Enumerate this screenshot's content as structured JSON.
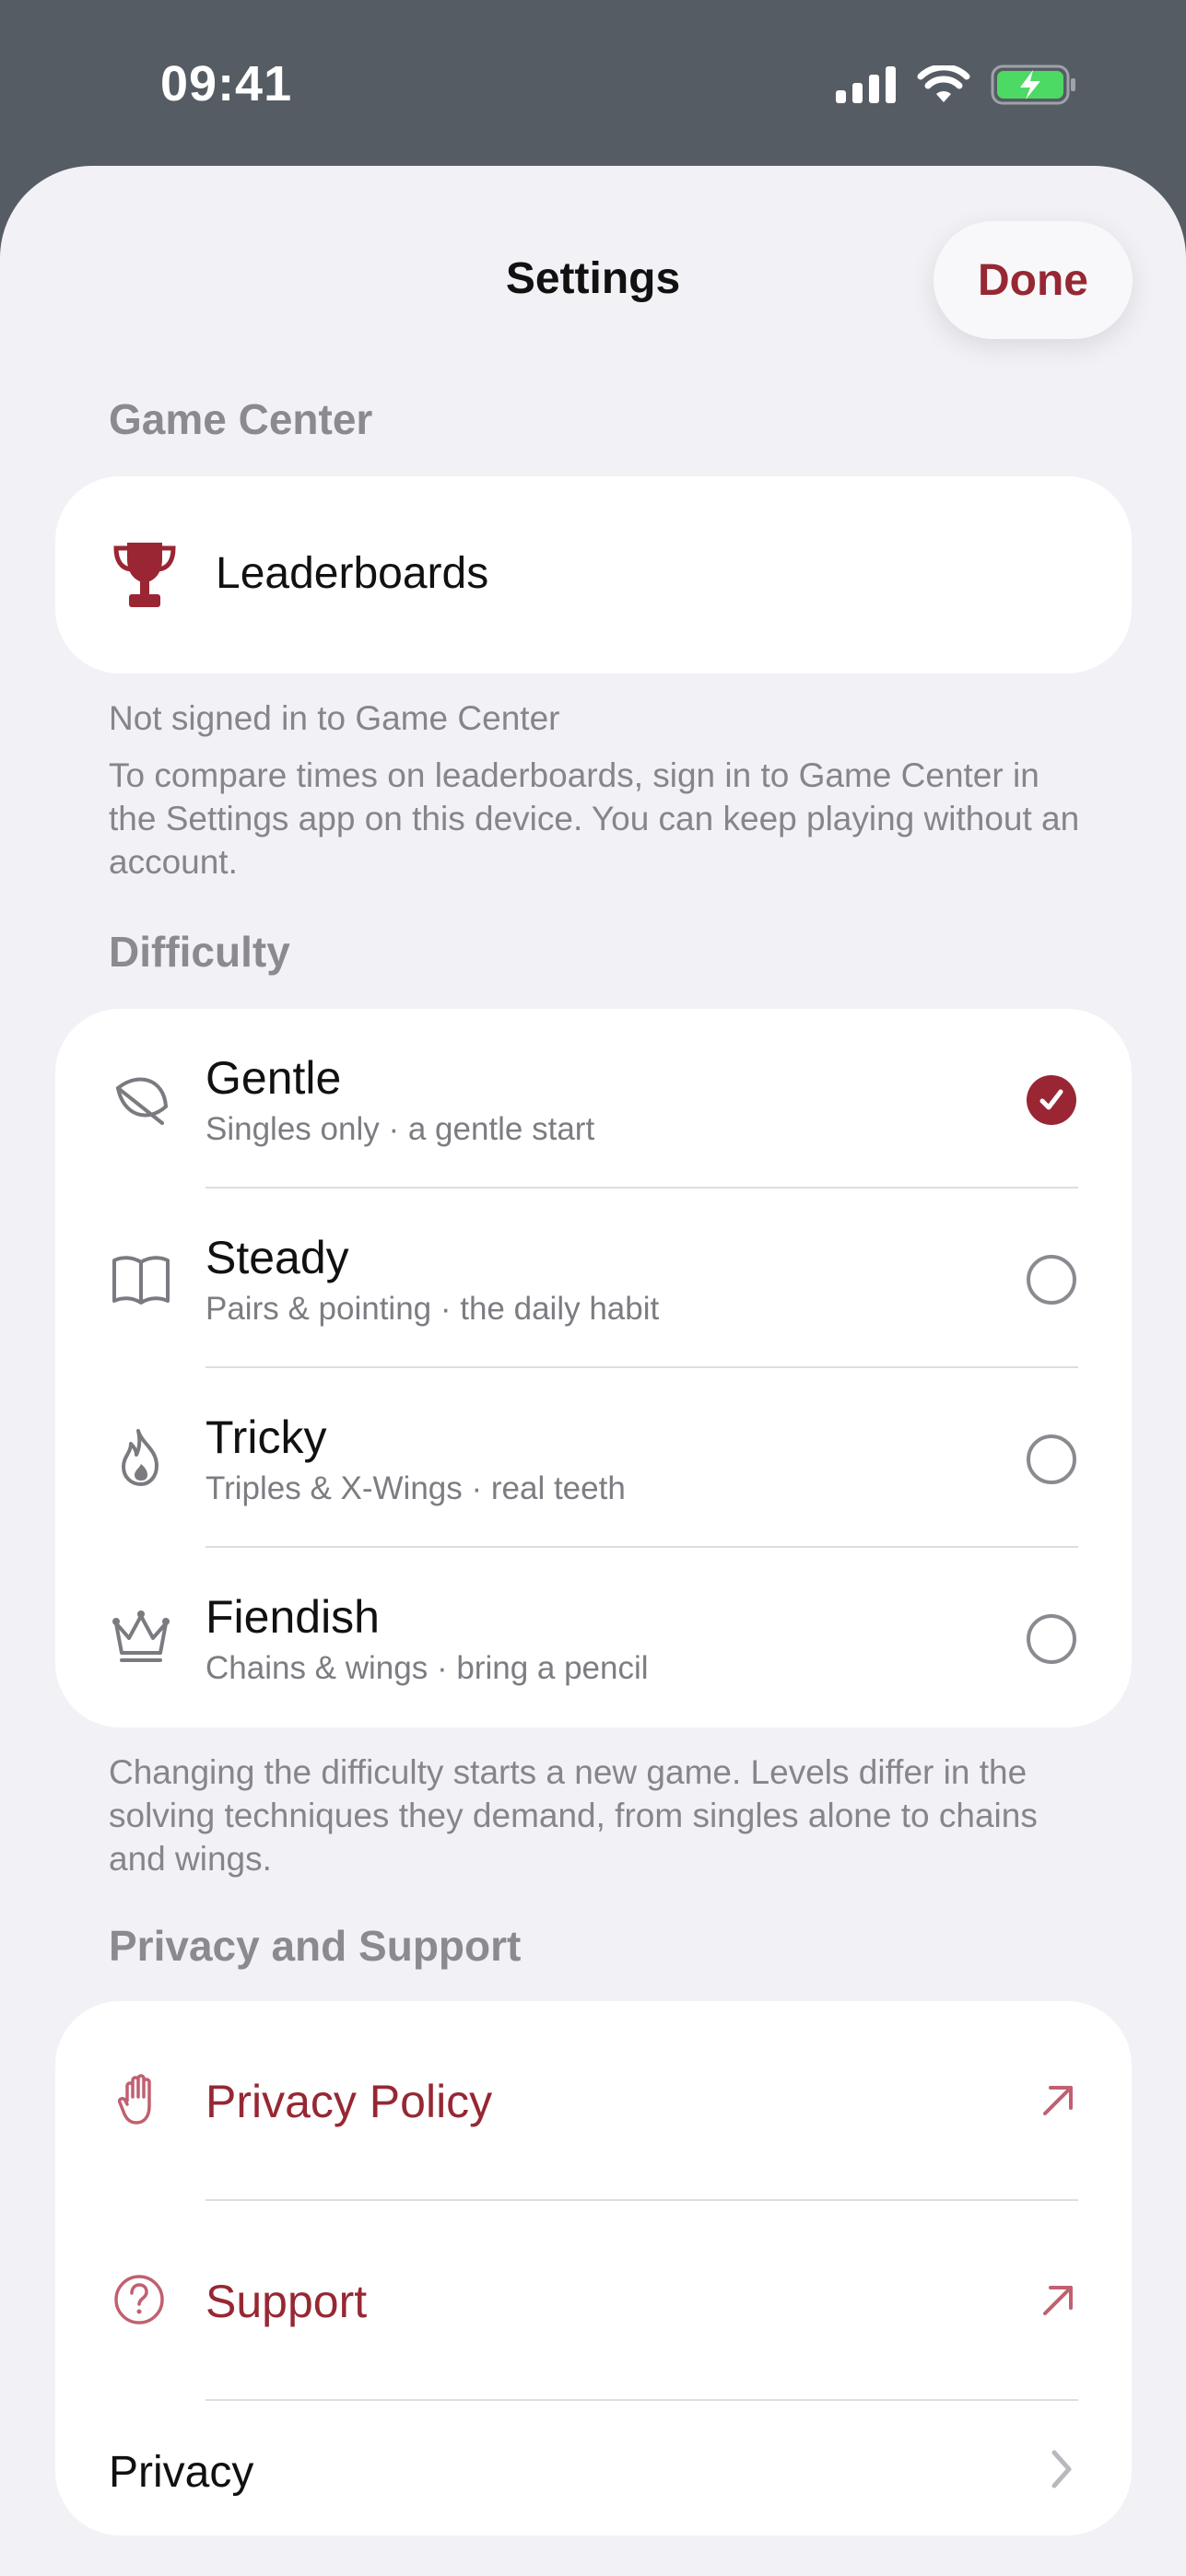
{
  "status_bar": {
    "time": "09:41",
    "battery_color": "#4cd964"
  },
  "header": {
    "title": "Settings",
    "done_label": "Done"
  },
  "colors": {
    "accent": "#962833",
    "background": "#f2f1f6",
    "card": "#ffffff"
  },
  "game_center": {
    "section_title": "Game Center",
    "row_label": "Leaderboards",
    "row_icon": "trophy-icon",
    "status_note": "Not signed in to Game Center",
    "description": "To compare times on leaderboards, sign in to Game Center in the Settings app on this device. You can keep playing without an account."
  },
  "difficulty": {
    "section_title": "Difficulty",
    "options": [
      {
        "title": "Gentle",
        "subtitle": "Singles only · a gentle start",
        "icon": "leaf-icon",
        "selected": true
      },
      {
        "title": "Steady",
        "subtitle": "Pairs & pointing · the daily habit",
        "icon": "book-icon",
        "selected": false
      },
      {
        "title": "Tricky",
        "subtitle": "Triples & X-Wings · real teeth",
        "icon": "flame-icon",
        "selected": false
      },
      {
        "title": "Fiendish",
        "subtitle": "Chains & wings · bring a pencil",
        "icon": "crown-icon",
        "selected": false
      }
    ],
    "footnote": "Changing the difficulty starts a new game. Levels differ in the solving techniques they demand, from singles alone to chains and wings."
  },
  "privacy_support": {
    "section_title": "Privacy and Support",
    "privacy_policy_label": "Privacy Policy",
    "support_label": "Support",
    "privacy_label": "Privacy"
  }
}
